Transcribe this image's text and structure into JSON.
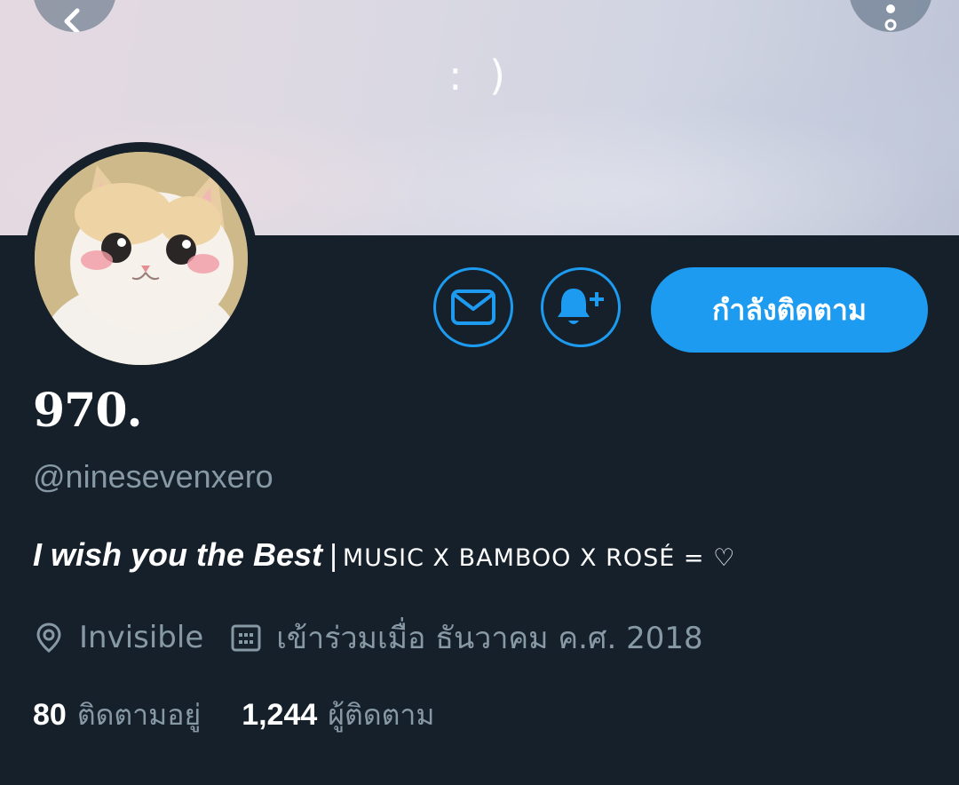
{
  "banner": {
    "text": ": )"
  },
  "header_buttons": {
    "back_icon": "chevron-left-icon",
    "more_icon": "more-dots-icon"
  },
  "profile": {
    "display_name": "970.",
    "handle": "@ninesevenxero",
    "bio": {
      "emphasis": "I wish you the Best",
      "separator": "|",
      "rest": "MUSIC X BAMBOO X ROSÉ = ♡"
    },
    "location": "Invisible",
    "joined": "เข้าร่วมเมื่อ ธันวาคม ค.ศ. 2018",
    "following_count": "80",
    "following_label": "ติดตามอยู่",
    "followers_count": "1,244",
    "followers_label": "ผู้ติดตาม"
  },
  "actions": {
    "message_icon": "envelope-icon",
    "notify_icon": "bell-plus-icon",
    "follow_label": "กำลังติดตาม"
  },
  "colors": {
    "background": "#15202b",
    "accent": "#1d9bf0",
    "secondary_text": "#8899a6",
    "primary_text": "#ffffff"
  }
}
